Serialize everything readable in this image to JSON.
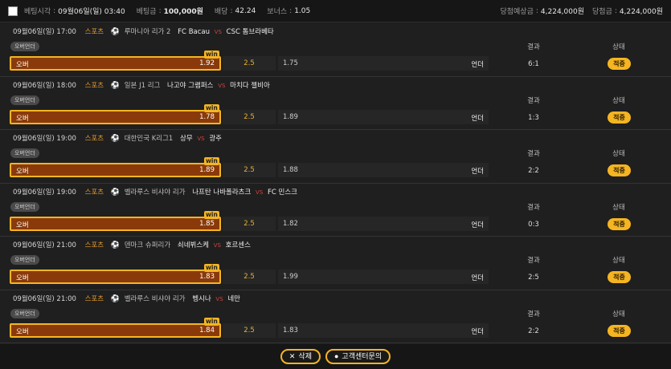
{
  "header": {
    "time_label": "베팅시각",
    "time_value": "09월06일(일) 03:40",
    "amount_label": "베팅금",
    "amount_value": "100,000원",
    "odds_label": "배당",
    "odds_value": "42.24",
    "bonus_label": "보너스",
    "bonus_value": "1.05",
    "expected_label": "당첨예상금",
    "expected_value": "4,224,000원",
    "won_label": "당첨금",
    "won_value": "4,224,000원"
  },
  "columns": {
    "result_label": "결과",
    "status_label": "상태"
  },
  "matches": [
    {
      "datetime": "09월06일(일) 17:00",
      "sport": "스포츠",
      "league": "루마니아 리가 2",
      "home": "FC Bacau",
      "vs": "VS",
      "away": "CSC 톰브라베타",
      "type": "오버언더",
      "pick": "오버",
      "win": "win",
      "pick_odds": "1.92",
      "base": "2.5",
      "under_odds": "1.75",
      "under_label": "언더",
      "result": "6:1",
      "status": "적중"
    },
    {
      "datetime": "09월06일(일) 18:00",
      "sport": "스포츠",
      "league": "일본 J1 리그",
      "home": "나고야 그램퍼스",
      "vs": "VS",
      "away": "마치다 젤비아",
      "type": "오버언더",
      "pick": "오버",
      "win": "win",
      "pick_odds": "1.78",
      "base": "2.5",
      "under_odds": "1.89",
      "under_label": "언더",
      "result": "1:3",
      "status": "적중"
    },
    {
      "datetime": "09월06일(일) 19:00",
      "sport": "스포츠",
      "league": "대한민국 K리그1",
      "home": "상무",
      "vs": "VS",
      "away": "광주",
      "type": "오버언더",
      "pick": "오버",
      "win": "win",
      "pick_odds": "1.89",
      "base": "2.5",
      "under_odds": "1.88",
      "under_label": "언더",
      "result": "2:2",
      "status": "적중"
    },
    {
      "datetime": "09월06일(일) 19:00",
      "sport": "스포츠",
      "league": "벨라루스 비샤야 리가",
      "home": "나프탄 나바폴라츠크",
      "vs": "VS",
      "away": "FC 민스크",
      "type": "오버언더",
      "pick": "오버",
      "win": "win",
      "pick_odds": "1.85",
      "base": "2.5",
      "under_odds": "1.82",
      "under_label": "언더",
      "result": "0:3",
      "status": "적중"
    },
    {
      "datetime": "09월06일(일) 21:00",
      "sport": "스포츠",
      "league": "덴마크 슈퍼리가",
      "home": "쇠네뷔스케",
      "vs": "VS",
      "away": "호르센스",
      "type": "오버언더",
      "pick": "오버",
      "win": "win",
      "pick_odds": "1.83",
      "base": "2.5",
      "under_odds": "1.99",
      "under_label": "언더",
      "result": "2:5",
      "status": "적중"
    },
    {
      "datetime": "09월06일(일) 21:00",
      "sport": "스포츠",
      "league": "벨라루스 비샤야 리가",
      "home": "벵시나",
      "vs": "VS",
      "away": "네만",
      "type": "오버언더",
      "pick": "오버",
      "win": "win",
      "pick_odds": "1.84",
      "base": "2.5",
      "under_odds": "1.83",
      "under_label": "언더",
      "result": "2:2",
      "status": "적중"
    }
  ],
  "footer": {
    "delete_label": "삭제",
    "support_label": "고객센터문의"
  },
  "icons": {
    "ball": "soccer-ball-icon",
    "delete": "close-icon",
    "support": "person-icon"
  },
  "colors": {
    "accent": "#f5b522",
    "pick_bg": "#8a3a0a",
    "vs": "#d0443c",
    "sport": "#e69a2c"
  }
}
